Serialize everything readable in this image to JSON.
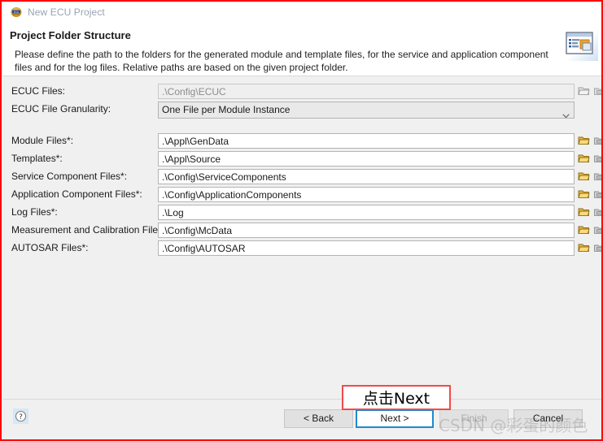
{
  "window": {
    "title": "New ECU Project",
    "app_icon": "ecu-project-icon",
    "accent_color": "#1c8ad1",
    "annotation_border_color": "#f24a4a",
    "body_background": "#f0f0f0"
  },
  "header": {
    "page_title": "Project Folder Structure",
    "description": "Please define the path to the folders for the generated module and template files, for the service and application component files and for the log files. Relative paths are based on the given project folder.",
    "banner_icon": "wizard-banner-icon"
  },
  "form": {
    "rows": [
      {
        "label": "ECUC Files:",
        "value": ".\\Config\\ECUC",
        "type": "text",
        "disabled": true,
        "has_icons": true
      },
      {
        "label": "ECUC File Granularity:",
        "value": "One File per Module Instance",
        "type": "combo",
        "disabled": false,
        "has_icons": false
      },
      {
        "label": "Module Files*:",
        "value": ".\\Appl\\GenData",
        "type": "text",
        "disabled": false,
        "has_icons": true
      },
      {
        "label": "Templates*:",
        "value": ".\\Appl\\Source",
        "type": "text",
        "disabled": false,
        "has_icons": true
      },
      {
        "label": "Service Component Files*:",
        "value": ".\\Config\\ServiceComponents",
        "type": "text",
        "disabled": false,
        "has_icons": true
      },
      {
        "label": "Application Component Files*:",
        "value": ".\\Config\\ApplicationComponents",
        "type": "text",
        "disabled": false,
        "has_icons": true
      },
      {
        "label": "Log Files*:",
        "value": ".\\Log",
        "type": "text",
        "disabled": false,
        "has_icons": true
      },
      {
        "label": "Measurement and Calibration Files*:",
        "value": ".\\Config\\McData",
        "type": "text",
        "disabled": false,
        "has_icons": true
      },
      {
        "label": "AUTOSAR Files*:",
        "value": ".\\Config\\AUTOSAR",
        "type": "text",
        "disabled": false,
        "has_icons": true
      }
    ],
    "row_icon_names": [
      "browse-folder-icon",
      "folder-variable-icon"
    ]
  },
  "footer": {
    "help_icon": "help-question-icon",
    "buttons": [
      {
        "label": "< Back",
        "style": "normal",
        "name": "back-button"
      },
      {
        "label": "Next >",
        "style": "primary",
        "name": "next-button"
      },
      {
        "label": "Finish",
        "style": "disabled",
        "name": "finish-button"
      },
      {
        "label": "Cancel",
        "style": "normal",
        "name": "cancel-button"
      }
    ]
  },
  "annotation": {
    "text": "点击Next"
  },
  "watermark": {
    "text": "CSDN @彩蛋的颜色"
  }
}
